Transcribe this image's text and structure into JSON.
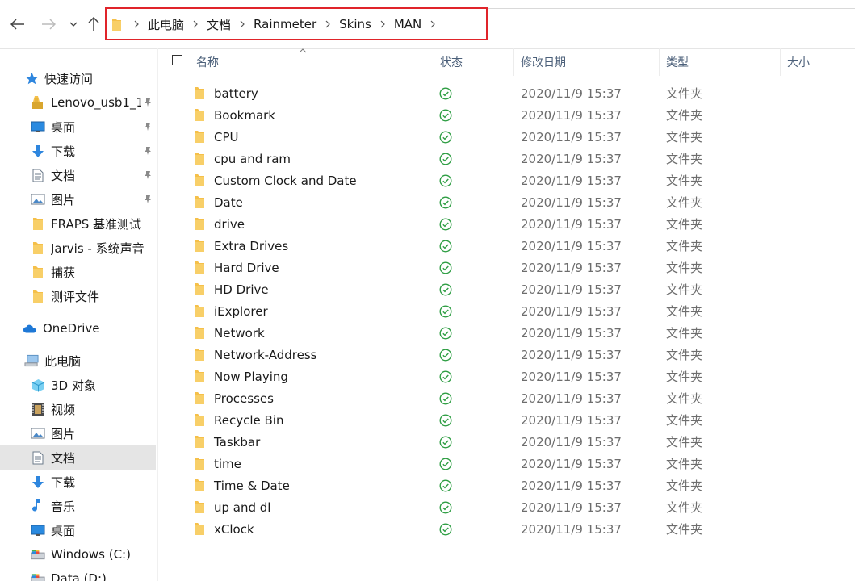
{
  "breadcrumb": [
    "此电脑",
    "文档",
    "Rainmeter",
    "Skins",
    "MAN"
  ],
  "columns": {
    "name": "名称",
    "status": "状态",
    "modified": "修改日期",
    "type": "类型",
    "size": "大小"
  },
  "sidebar": {
    "items": [
      {
        "label": "快速访问",
        "icon": "star-icon",
        "pinned": false
      },
      {
        "label": "Lenovo_usb1_1",
        "icon": "usb-drive-icon",
        "pinned": true
      },
      {
        "label": "桌面",
        "icon": "desktop-icon",
        "pinned": true
      },
      {
        "label": "下载",
        "icon": "download-icon",
        "pinned": true
      },
      {
        "label": "文档",
        "icon": "document-icon",
        "pinned": true
      },
      {
        "label": "图片",
        "icon": "pictures-icon",
        "pinned": true
      },
      {
        "label": "FRAPS 基准测试",
        "icon": "folder-icon",
        "pinned": false
      },
      {
        "label": "Jarvis - 系统声音",
        "icon": "folder-icon",
        "pinned": false
      },
      {
        "label": "捕获",
        "icon": "folder-icon",
        "pinned": false
      },
      {
        "label": "测评文件",
        "icon": "folder-icon",
        "pinned": false
      },
      {
        "label": "OneDrive",
        "icon": "cloud-icon",
        "pinned": false
      },
      {
        "label": "此电脑",
        "icon": "computer-icon",
        "pinned": false
      },
      {
        "label": "3D 对象",
        "icon": "3d-objects-icon",
        "pinned": false
      },
      {
        "label": "视频",
        "icon": "video-icon",
        "pinned": false
      },
      {
        "label": "图片",
        "icon": "pictures-icon",
        "pinned": false
      },
      {
        "label": "文档",
        "icon": "document-icon",
        "pinned": false,
        "selected": true
      },
      {
        "label": "下载",
        "icon": "download-icon",
        "pinned": false
      },
      {
        "label": "音乐",
        "icon": "music-icon",
        "pinned": false
      },
      {
        "label": "桌面",
        "icon": "desktop-icon",
        "pinned": false
      },
      {
        "label": "Windows (C:)",
        "icon": "drive-icon",
        "pinned": false
      },
      {
        "label": "Data (D:)",
        "icon": "drive-icon",
        "pinned": false
      }
    ]
  },
  "files": [
    {
      "name": "battery",
      "date": "2020/11/9 15:37",
      "type": "文件夹"
    },
    {
      "name": "Bookmark",
      "date": "2020/11/9 15:37",
      "type": "文件夹"
    },
    {
      "name": "CPU",
      "date": "2020/11/9 15:37",
      "type": "文件夹"
    },
    {
      "name": "cpu and ram",
      "date": "2020/11/9 15:37",
      "type": "文件夹"
    },
    {
      "name": "Custom Clock and Date",
      "date": "2020/11/9 15:37",
      "type": "文件夹"
    },
    {
      "name": "Date",
      "date": "2020/11/9 15:37",
      "type": "文件夹"
    },
    {
      "name": "drive",
      "date": "2020/11/9 15:37",
      "type": "文件夹"
    },
    {
      "name": "Extra Drives",
      "date": "2020/11/9 15:37",
      "type": "文件夹"
    },
    {
      "name": "Hard Drive",
      "date": "2020/11/9 15:37",
      "type": "文件夹"
    },
    {
      "name": "HD Drive",
      "date": "2020/11/9 15:37",
      "type": "文件夹"
    },
    {
      "name": "iExplorer",
      "date": "2020/11/9 15:37",
      "type": "文件夹"
    },
    {
      "name": "Network",
      "date": "2020/11/9 15:37",
      "type": "文件夹"
    },
    {
      "name": "Network-Address",
      "date": "2020/11/9 15:37",
      "type": "文件夹"
    },
    {
      "name": "Now Playing",
      "date": "2020/11/9 15:37",
      "type": "文件夹"
    },
    {
      "name": "Processes",
      "date": "2020/11/9 15:37",
      "type": "文件夹"
    },
    {
      "name": "Recycle Bin",
      "date": "2020/11/9 15:37",
      "type": "文件夹"
    },
    {
      "name": "Taskbar",
      "date": "2020/11/9 15:37",
      "type": "文件夹"
    },
    {
      "name": "time",
      "date": "2020/11/9 15:37",
      "type": "文件夹"
    },
    {
      "name": "Time & Date",
      "date": "2020/11/9 15:37",
      "type": "文件夹"
    },
    {
      "name": "up and dl",
      "date": "2020/11/9 15:37",
      "type": "文件夹"
    },
    {
      "name": "xClock",
      "date": "2020/11/9 15:37",
      "type": "文件夹"
    }
  ],
  "colors": {
    "highlight_border": "#e0242a",
    "folder": "#f5c04a",
    "sync_ok": "#2f9e44",
    "selected_bg": "#e5e5e5"
  }
}
